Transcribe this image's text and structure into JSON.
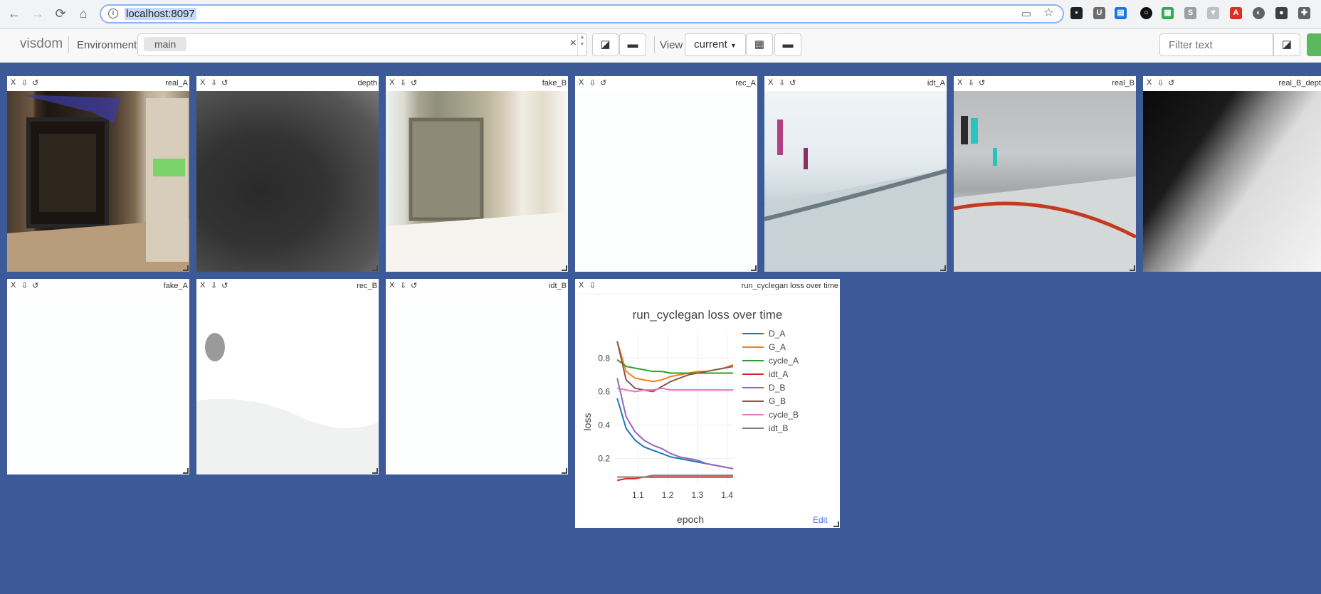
{
  "browser": {
    "url": "localhost:8097"
  },
  "toolbar": {
    "brand": "visdom",
    "environment_label": "Environment",
    "environment_tag": "main",
    "clear_symbol": "×",
    "view_label": "View",
    "view_value": "current",
    "filter_placeholder": "Filter text"
  },
  "panes": [
    {
      "title": "real_A"
    },
    {
      "title": "depth"
    },
    {
      "title": "fake_B"
    },
    {
      "title": "rec_A"
    },
    {
      "title": "idt_A"
    },
    {
      "title": "real_B"
    },
    {
      "title": "real_B_depth"
    },
    {
      "title": "fake_A"
    },
    {
      "title": "rec_B"
    },
    {
      "title": "idt_B"
    }
  ],
  "plot_pane": {
    "title": "run_cyclegan loss over time",
    "edit_label": "Edit"
  },
  "pane_controls": {
    "close": "X",
    "download": "⇩",
    "reset": "↺"
  },
  "chart_data": {
    "type": "line",
    "title": "run_cyclegan loss over time",
    "xlabel": "epoch",
    "ylabel": "loss",
    "xlim": [
      1.02,
      1.42
    ],
    "ylim": [
      0.05,
      0.95
    ],
    "xticks": [
      1.1,
      1.2,
      1.3,
      1.4
    ],
    "yticks": [
      0.2,
      0.4,
      0.6,
      0.8
    ],
    "xtick_labels": [
      "1.1",
      "1.2",
      "1.3",
      "1.4"
    ],
    "ytick_labels": [
      "0.2",
      "0.4",
      "0.6",
      "0.8"
    ],
    "grid": true,
    "legend_position": "right",
    "x": [
      1.03,
      1.06,
      1.09,
      1.12,
      1.15,
      1.18,
      1.21,
      1.24,
      1.27,
      1.3,
      1.33,
      1.36,
      1.39,
      1.42
    ],
    "series": [
      {
        "name": "D_A",
        "color": "#1f77b4",
        "values": [
          0.56,
          0.38,
          0.31,
          0.27,
          0.25,
          0.23,
          0.21,
          0.2,
          0.19,
          0.18,
          0.17,
          0.16,
          0.15,
          0.14
        ]
      },
      {
        "name": "G_A",
        "color": "#ff7f0e",
        "values": [
          0.9,
          0.72,
          0.68,
          0.67,
          0.66,
          0.67,
          0.69,
          0.7,
          0.71,
          0.72,
          0.72,
          0.73,
          0.74,
          0.76
        ]
      },
      {
        "name": "cycle_A",
        "color": "#2ca02c",
        "values": [
          0.79,
          0.75,
          0.74,
          0.73,
          0.72,
          0.72,
          0.71,
          0.71,
          0.71,
          0.71,
          0.71,
          0.71,
          0.71,
          0.71
        ]
      },
      {
        "name": "idt_A",
        "color": "#d62728",
        "values": [
          0.07,
          0.08,
          0.08,
          0.09,
          0.09,
          0.09,
          0.09,
          0.09,
          0.09,
          0.09,
          0.09,
          0.09,
          0.09,
          0.09
        ]
      },
      {
        "name": "D_B",
        "color": "#9467bd",
        "values": [
          0.68,
          0.45,
          0.36,
          0.31,
          0.28,
          0.26,
          0.23,
          0.21,
          0.2,
          0.19,
          0.17,
          0.16,
          0.15,
          0.14
        ]
      },
      {
        "name": "G_B",
        "color": "#8c564b",
        "values": [
          0.9,
          0.67,
          0.62,
          0.61,
          0.6,
          0.63,
          0.66,
          0.68,
          0.7,
          0.71,
          0.72,
          0.73,
          0.74,
          0.75
        ]
      },
      {
        "name": "cycle_B",
        "color": "#e377c2",
        "values": [
          0.62,
          0.61,
          0.6,
          0.61,
          0.61,
          0.62,
          0.61,
          0.61,
          0.61,
          0.61,
          0.61,
          0.61,
          0.61,
          0.61
        ]
      },
      {
        "name": "idt_B",
        "color": "#7f7f7f",
        "values": [
          0.09,
          0.09,
          0.09,
          0.09,
          0.1,
          0.1,
          0.1,
          0.1,
          0.1,
          0.1,
          0.1,
          0.1,
          0.1,
          0.1
        ]
      }
    ]
  }
}
